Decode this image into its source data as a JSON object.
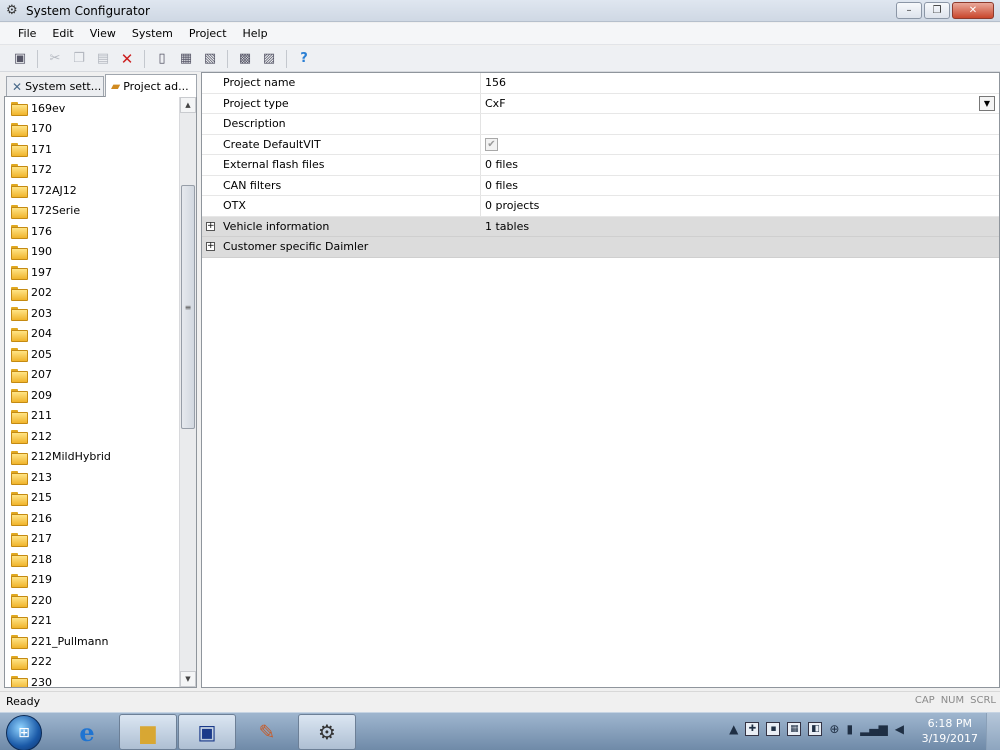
{
  "window": {
    "title": "System Configurator",
    "controls": {
      "minimize": "–",
      "maximize": "❐",
      "close": "✕"
    }
  },
  "menu": [
    "File",
    "Edit",
    "View",
    "System",
    "Project",
    "Help"
  ],
  "toolbar": {
    "icons": [
      "save-icon",
      "cut-icon",
      "copy-icon",
      "paste-icon",
      "delete-icon",
      "new-icon",
      "save-as-icon",
      "export-icon",
      "import-icon",
      "remove-icon",
      "help-icon"
    ]
  },
  "left_tabs": {
    "system_settings": "System sett...",
    "project_admin": "Project ad..."
  },
  "tree_items": [
    "169ev",
    "170",
    "171",
    "172",
    "172AJ12",
    "172Serie",
    "176",
    "190",
    "197",
    "202",
    "203",
    "204",
    "205",
    "207",
    "209",
    "211",
    "212",
    "212MildHybrid",
    "213",
    "215",
    "216",
    "217",
    "218",
    "219",
    "220",
    "221",
    "221_Pullmann",
    "222",
    "230"
  ],
  "properties": [
    {
      "name": "Project name",
      "value": "156"
    },
    {
      "name": "Project type",
      "value": "CxF"
    },
    {
      "name": "Description",
      "value": ""
    },
    {
      "name": "Create DefaultVIT",
      "value": ""
    },
    {
      "name": "External flash files",
      "value": "0 files"
    },
    {
      "name": "CAN filters",
      "value": "0 files"
    },
    {
      "name": "OTX",
      "value": "0 projects"
    },
    {
      "name": "Vehicle information",
      "value": "1 tables"
    },
    {
      "name": "Customer specific Daimler",
      "value": ""
    }
  ],
  "create_default_vit_checked": true,
  "status": {
    "text": "Ready",
    "flags": [
      "CAP",
      "NUM",
      "SCRL"
    ]
  },
  "taskbar": {
    "clock_time": "6:18 PM",
    "clock_date": "3/19/2017"
  },
  "colors": {
    "group_row": "#dcdcdc",
    "folder": "#f0b42c",
    "taskbar": "#8aa3bf"
  }
}
